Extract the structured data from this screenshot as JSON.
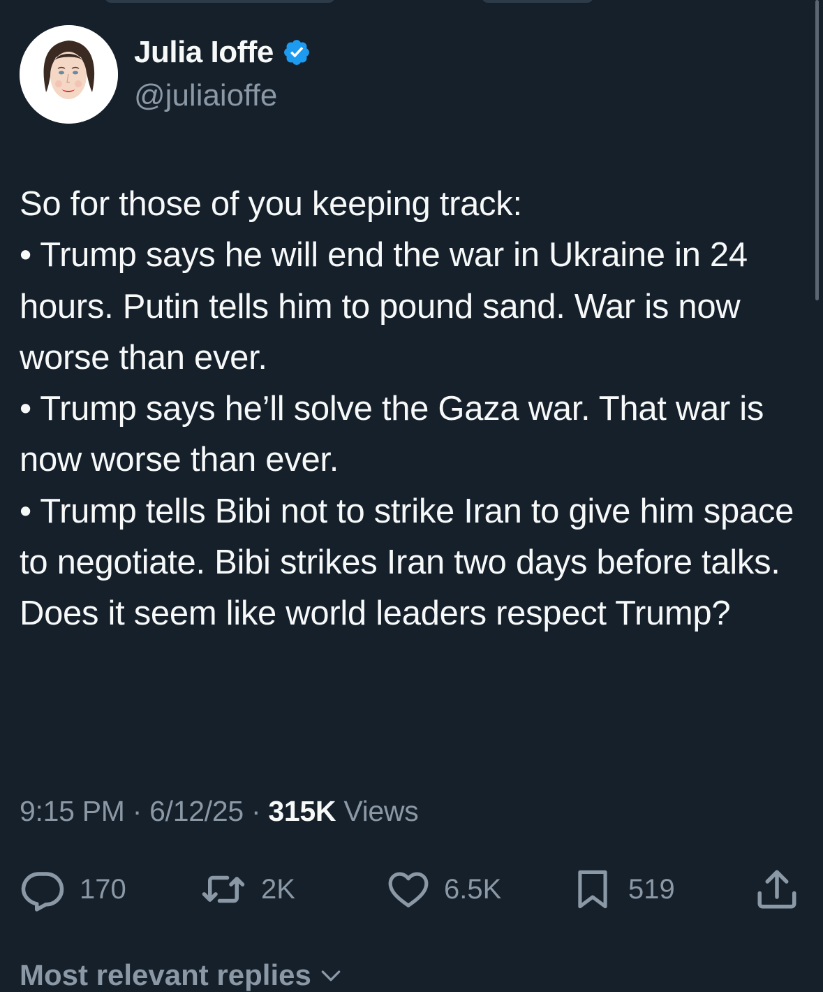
{
  "author": {
    "name": "Julia Ioffe",
    "handle": "@juliaioffe",
    "verified": true,
    "avatar_icon": "avatar-illustration-woman"
  },
  "tweet": {
    "lines": [
      "So for those of you keeping track:",
      "• Trump says he will end the war in Ukraine in 24 hours. Putin tells him to pound sand. War is now worse than ever.",
      "• Trump says he’ll solve the Gaza war. That war is now worse than ever.",
      "• Trump tells Bibi not to strike Iran to give him space to negotiate. Bibi strikes Iran two days before talks.",
      "Does it seem like world leaders respect Trump?"
    ],
    "time": "9:15 PM",
    "date": "6/12/25",
    "separator": "·",
    "views_count": "315K",
    "views_label": "Views"
  },
  "actions": {
    "reply_count": "170",
    "retweet_count": "2K",
    "like_count": "6.5K",
    "bookmark_count": "519"
  },
  "replies": {
    "sort_label": "Most relevant replies"
  },
  "colors": {
    "background": "#15202b",
    "text": "#f7f9f9",
    "muted": "#8b98a5",
    "verified_blue": "#1d9bf0"
  }
}
